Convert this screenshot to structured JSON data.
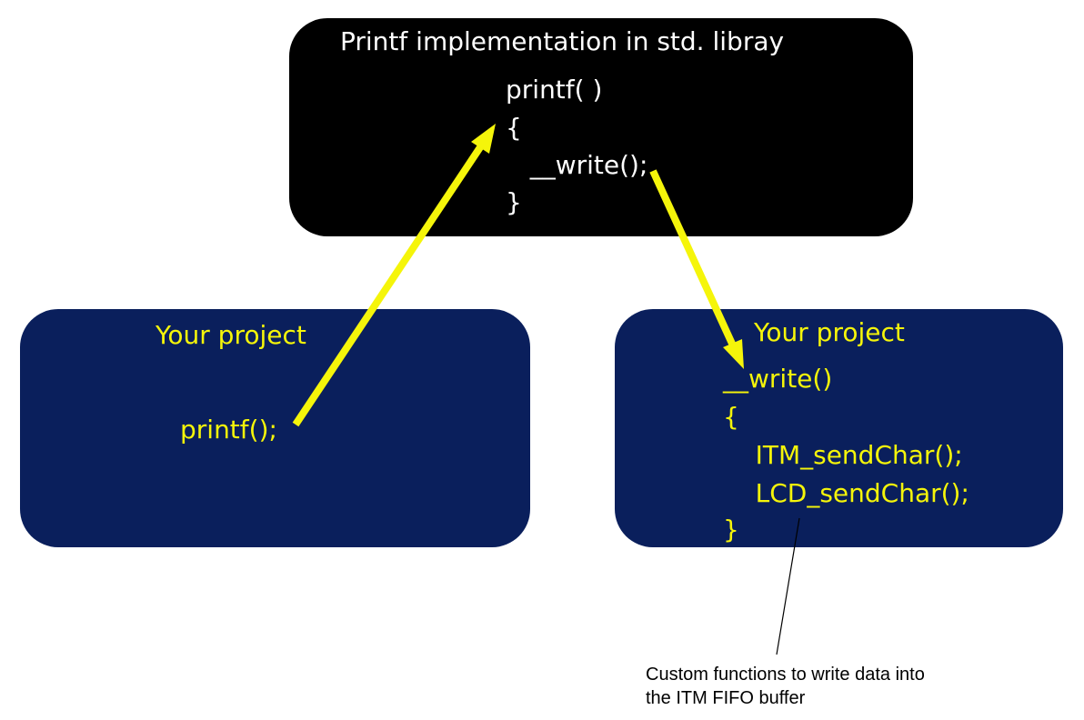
{
  "library_box": {
    "title": "Printf implementation in std. libray",
    "code": [
      "printf( )",
      "{",
      "   __write();",
      "}"
    ]
  },
  "left_box": {
    "title": "Your project",
    "code": [
      "printf();"
    ]
  },
  "right_box": {
    "title": "Your project",
    "code": [
      "__write()",
      "{",
      "    ITM_sendChar();",
      "    LCD_sendChar();",
      "}"
    ]
  },
  "annotation": {
    "lines": [
      "Custom functions to write data into",
      "the ITM FIFO buffer"
    ]
  },
  "colors": {
    "library_box": "#000000",
    "project_box": "#0a1f5c",
    "arrow": "#f5f50a",
    "library_text": "#ffffff",
    "project_text": "#f5f50a"
  }
}
